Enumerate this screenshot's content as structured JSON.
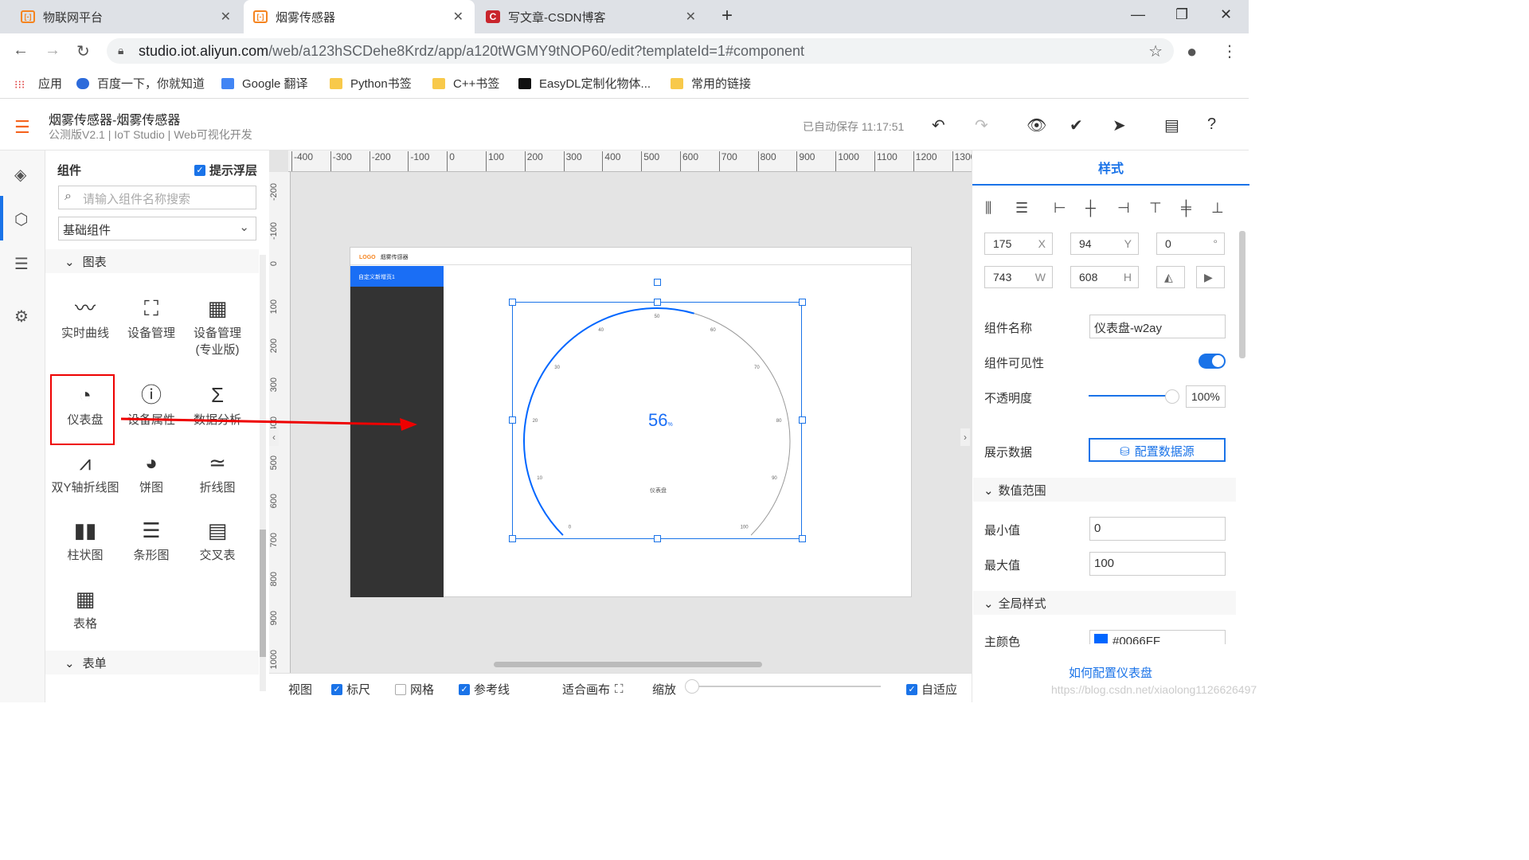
{
  "tabs": [
    {
      "label": "物联网平台"
    },
    {
      "label": "烟雾传感器"
    },
    {
      "label": "写文章-CSDN博客"
    }
  ],
  "address": {
    "domain": "studio.iot.aliyun.com",
    "path": "/web/a123hSCDehe8Krdz/app/a120tWGMY9tNOP60/edit?templateId=1#component"
  },
  "bookmarks": [
    "应用",
    "百度一下，你就知道",
    "Google 翻译",
    "Python书签",
    "C++书签",
    "EasyDL定制化物体...",
    "常用的链接"
  ],
  "header": {
    "title": "烟雾传感器-烟雾传感器",
    "subtitle": "公测版V2.1 | IoT Studio | Web可视化开发",
    "autosave": "已自动保存 11:17:51"
  },
  "panel": {
    "title": "组件",
    "hint_label": "提示浮层",
    "search_placeholder": "请输入组件名称搜索",
    "category": "基础组件",
    "group_chart": "图表",
    "group_form": "表单",
    "components": [
      {
        "label": "实时曲线",
        "icon": "realtime-curve-icon"
      },
      {
        "label": "设备管理",
        "icon": "device-manage-icon"
      },
      {
        "label": "设备管理\n(专业版)",
        "icon": "device-manage-pro-icon"
      },
      {
        "label": "仪表盘",
        "icon": "gauge-icon"
      },
      {
        "label": "设备属性",
        "icon": "device-property-icon"
      },
      {
        "label": "数据分析",
        "icon": "data-analysis-icon"
      },
      {
        "label": "双Y轴折线图",
        "icon": "dual-y-line-icon"
      },
      {
        "label": "饼图",
        "icon": "pie-chart-icon"
      },
      {
        "label": "折线图",
        "icon": "line-chart-icon"
      },
      {
        "label": "柱状图",
        "icon": "bar-chart-icon"
      },
      {
        "label": "条形图",
        "icon": "hbar-chart-icon"
      },
      {
        "label": "交叉表",
        "icon": "cross-table-icon"
      },
      {
        "label": "表格",
        "icon": "table-icon"
      }
    ]
  },
  "ruler_x": [
    "-400",
    "-300",
    "-200",
    "-100",
    "0",
    "100",
    "200",
    "300",
    "400",
    "500",
    "600",
    "700",
    "800",
    "900",
    "1000",
    "1100",
    "1200",
    "1300"
  ],
  "ruler_y": [
    "-200",
    "-100",
    "0",
    "100",
    "200",
    "300",
    "400",
    "500",
    "600",
    "700",
    "800",
    "900",
    "1000"
  ],
  "page": {
    "logo": "LOGO",
    "site_title": "烟雾传感器",
    "nav_item": "自定义新增页1"
  },
  "gauge": {
    "value": "56",
    "unit": "%",
    "label": "仪表盘",
    "min": 0,
    "max": 100,
    "ticks": [
      "0",
      "10",
      "20",
      "30",
      "40",
      "50",
      "60",
      "70",
      "80",
      "90",
      "100"
    ]
  },
  "canvas_bar": {
    "view": "视图",
    "ruler": "标尺",
    "grid": "网格",
    "guides": "参考线",
    "fit": "适合画布",
    "zoom": "缩放",
    "adaptive": "自适应"
  },
  "style_panel": {
    "tab": "样式",
    "x": "175",
    "x_unit": "X",
    "y": "94",
    "y_unit": "Y",
    "rot": "0",
    "rot_unit": "°",
    "w": "743",
    "w_unit": "W",
    "h": "608",
    "h_unit": "H",
    "name_label": "组件名称",
    "name_value": "仪表盘-w2ay",
    "visible_label": "组件可见性",
    "opacity_label": "不透明度",
    "opacity_value": "100%",
    "data_label": "展示数据",
    "data_button": "配置数据源",
    "range_section": "数值范围",
    "min_label": "最小值",
    "min_value": "0",
    "max_label": "最大值",
    "max_value": "100",
    "global_section": "全局样式",
    "main_color_label": "主颜色",
    "main_color_value": "#0066FF",
    "help_link": "如何配置仪表盘"
  },
  "watermark": "https://blog.csdn.net/xiaolong1126626497",
  "colors": {
    "accent": "#1a73e8",
    "brand_orange": "#f5641f",
    "gauge_blue": "#0066FF"
  }
}
